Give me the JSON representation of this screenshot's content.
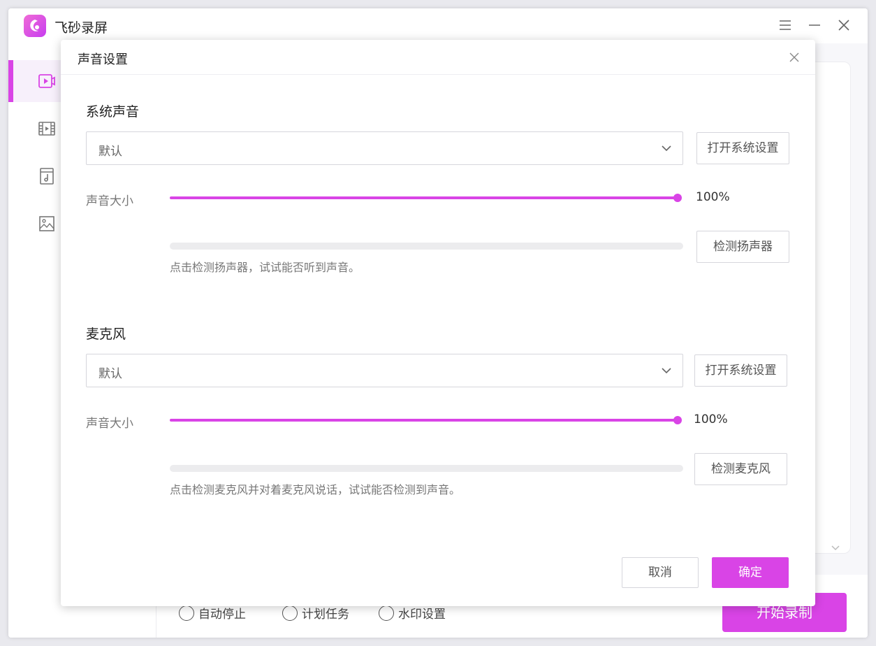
{
  "app": {
    "title": "飞砂录屏",
    "accent_color": "#d944e6"
  },
  "window_controls": [
    "menu-icon",
    "minimize-icon",
    "close-icon"
  ],
  "sidebar": {
    "items": [
      {
        "icon": "screen-record-icon",
        "active": true
      },
      {
        "icon": "video-film-icon",
        "active": false
      },
      {
        "icon": "audio-music-icon",
        "active": false
      },
      {
        "icon": "image-screenshot-icon",
        "active": false
      }
    ]
  },
  "background": {
    "options": [
      "自动停止",
      "计划任务",
      "水印设置"
    ],
    "start_button": "开始录制"
  },
  "dialog": {
    "title": "声音设置",
    "system_sound": {
      "section_title": "系统声音",
      "device": "默认",
      "open_settings_label": "打开系统设置",
      "volume_label": "声音大小",
      "volume_percent": 100,
      "volume_text": "100%",
      "level_fraction": 0,
      "test_label": "检测扬声器",
      "hint": "点击检测扬声器，试试能否听到声音。"
    },
    "microphone": {
      "section_title": "麦克风",
      "device": "默认",
      "open_settings_label": "打开系统设置",
      "volume_label": "声音大小",
      "volume_percent": 100,
      "volume_text": "100%",
      "level_fraction": 0,
      "test_label": "检测麦克风",
      "hint": "点击检测麦克风并对着麦克风说话，试试能否检测到声音。"
    },
    "cancel_label": "取消",
    "ok_label": "确定"
  }
}
